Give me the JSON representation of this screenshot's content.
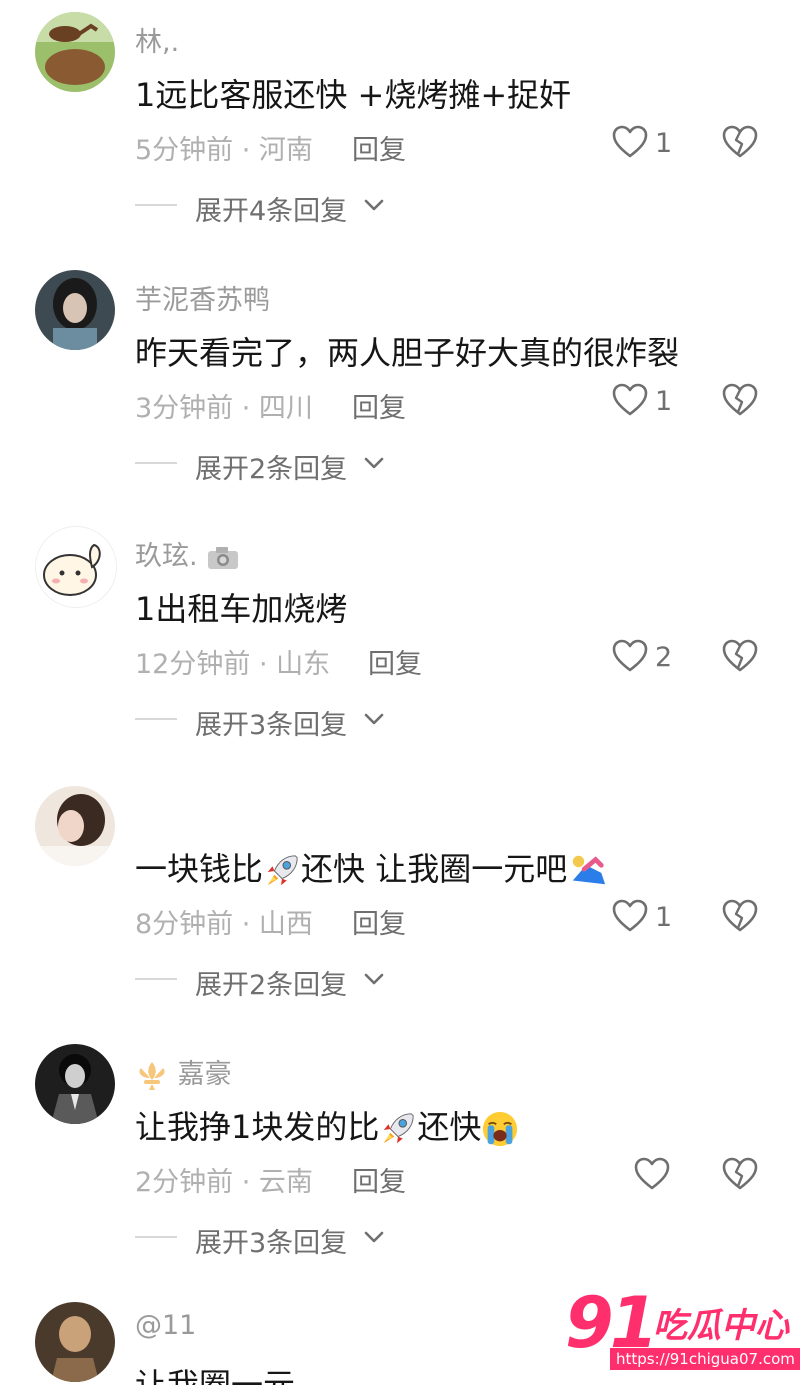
{
  "comments": [
    {
      "user": "林,.",
      "text": "1远比客服还快 +烧烤摊+捉奸",
      "time_loc": "5分钟前 · 河南",
      "reply": "回复",
      "likes": "1",
      "expand": "展开4条回复"
    },
    {
      "user": "芋泥香苏鸭",
      "text": "昨天看完了，两人胆子好大真的很炸裂",
      "time_loc": "3分钟前 · 四川",
      "reply": "回复",
      "likes": "1",
      "expand": "展开2条回复"
    },
    {
      "user": "玖玹.",
      "text": "1出租车加烧烤",
      "time_loc": "12分钟前 · 山东",
      "reply": "回复",
      "likes": "2",
      "expand": "展开3条回复"
    },
    {
      "user": "",
      "text_a": "一块钱比",
      "text_b": "还快 让我圈一元吧",
      "time_loc": "8分钟前 · 山西",
      "reply": "回复",
      "likes": "1",
      "expand": "展开2条回复"
    },
    {
      "user": "嘉豪",
      "text_a": "让我挣1块发的比",
      "text_b": "还快",
      "time_loc": "2分钟前 · 云南",
      "reply": "回复",
      "likes": "",
      "expand": "展开3条回复"
    },
    {
      "user": "@11",
      "text": "让我圈一元"
    }
  ],
  "icons": {
    "like": "heart-outline-icon",
    "dislike": "broken-heart-icon",
    "expand": "chevron-down-icon",
    "emoji_rocket": "rocket-emoji",
    "emoji_cry": "crying-face-emoji",
    "emoji_dive": "diving-emoji",
    "badge_camera": "camera-icon",
    "badge_fleur": "fleur-de-lis-icon"
  },
  "watermark": {
    "number": "91",
    "title": "吃瓜中心",
    "url": "https://91chigua07.com"
  },
  "colors": {
    "username": "#9a9a9a",
    "meta": "#b0b0b0",
    "text": "#161616",
    "watermark": "#ff2f6e"
  }
}
